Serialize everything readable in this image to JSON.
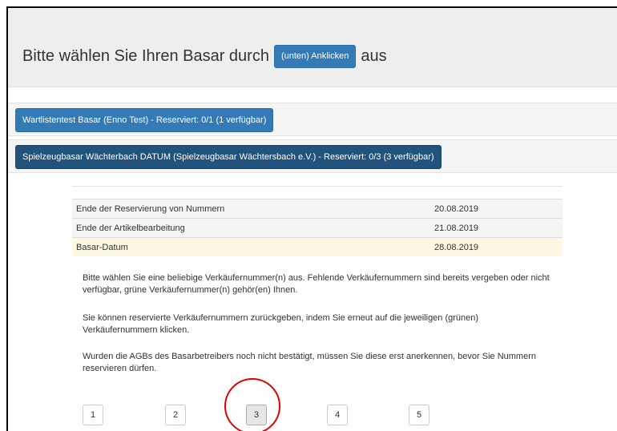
{
  "header": {
    "title_prefix": "Bitte wählen Sie Ihren Basar durch",
    "button_label": "(unten) Anklicken",
    "title_suffix": "aus"
  },
  "bazaars": [
    {
      "label": "Wartlistentest Basar (Enno Test) - Reserviert: 0/1 (1 verfügbar)"
    },
    {
      "label": "Spielzeugbasar Wächterbach DATUM (Spielzeugbasar Wächtersbach e.V.) - Reserviert: 0/3 (3 verfügbar)"
    }
  ],
  "info_table": [
    {
      "label": "Ende der Reservierung von Nummern",
      "date": "20.08.2019"
    },
    {
      "label": "Ende der Artikelbearbeitung",
      "date": "21.08.2019"
    },
    {
      "label": "Basar-Datum",
      "date": "28.08.2019"
    }
  ],
  "paragraphs": [
    "Bitte wählen Sie eine beliebige Verkäufernummer(n) aus. Fehlende Verkäufernummern sind bereits vergeben oder nicht verfügbar, grüne Verkäufernummer(n) gehör(en) Ihnen.",
    "Sie können reservierte Verkäufernummern zurückgeben, indem Sie erneut auf die jeweiligen (grünen) Verkäufernummern klicken.",
    "Wurden die AGBs des Basarbetreibers noch nicht bestätigt, müssen Sie diese erst anerkennen, bevor Sie Nummern reservieren dürfen."
  ],
  "numbers": [
    "1",
    "2",
    "3",
    "4",
    "5"
  ],
  "highlighted_number": "3",
  "colors": {
    "primary": "#337ab7",
    "primary_dark": "#23527c",
    "highlight_row": "#fcf8e3",
    "annotation_circle": "#e00000"
  }
}
